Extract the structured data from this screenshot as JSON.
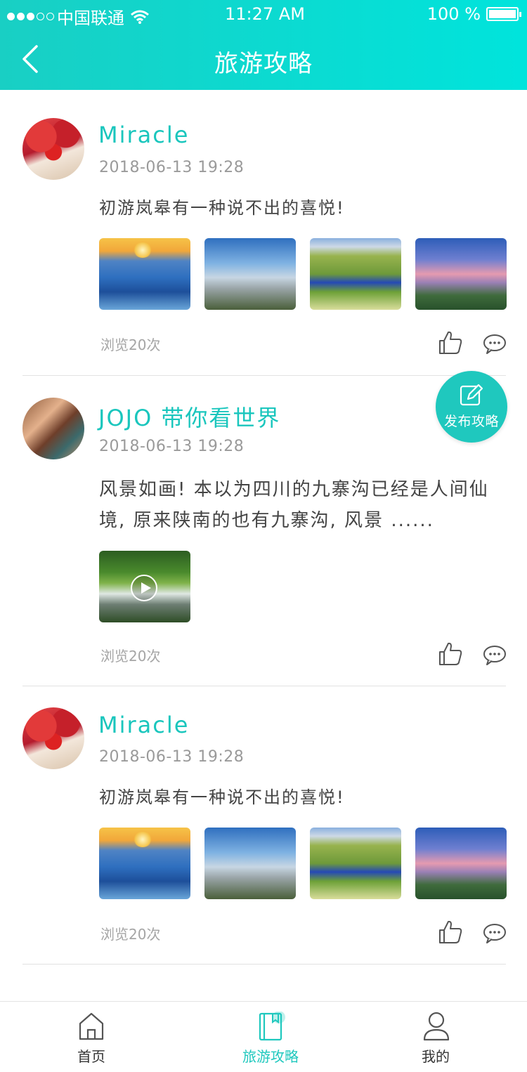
{
  "status_bar": {
    "carrier": "中国联通",
    "time": "11:27 AM",
    "battery": "100 %"
  },
  "header": {
    "title": "旅游攻略"
  },
  "posts": [
    {
      "username": "Miracle",
      "date": "2018-06-13  19:28",
      "text": "初游岚皋有一种说不出的喜悦!",
      "images": [
        "sunset-sea",
        "foggy-mountains",
        "green-hill-lake",
        "valley-dusk"
      ],
      "views": "浏览20次"
    },
    {
      "username": "JOJO 带你看世界",
      "date": "2018-06-13  19:28",
      "text": "风景如画! 本以为四川的九寨沟已经是人间仙境, 原来陕南的也有九寨沟, 风景 ......",
      "images": [
        "forest-stream-video"
      ],
      "views": "浏览20次"
    },
    {
      "username": "Miracle",
      "date": "2018-06-13  19:28",
      "text": "初游岚皋有一种说不出的喜悦!",
      "images": [
        "sunset-sea",
        "foggy-mountains",
        "green-hill-lake",
        "valley-dusk"
      ],
      "views": "浏览20次"
    }
  ],
  "fab": {
    "label": "发布攻略",
    "icon": "edit-icon"
  },
  "tabbar": {
    "items": [
      {
        "label": "首页",
        "icon": "home-icon"
      },
      {
        "label": "旅游攻略",
        "icon": "guide-book-icon",
        "active": true
      },
      {
        "label": "我的",
        "icon": "user-icon"
      }
    ]
  },
  "colors": {
    "accent": "#1fc8be",
    "header_start": "#19cfc4",
    "header_end": "#00e4dc"
  }
}
